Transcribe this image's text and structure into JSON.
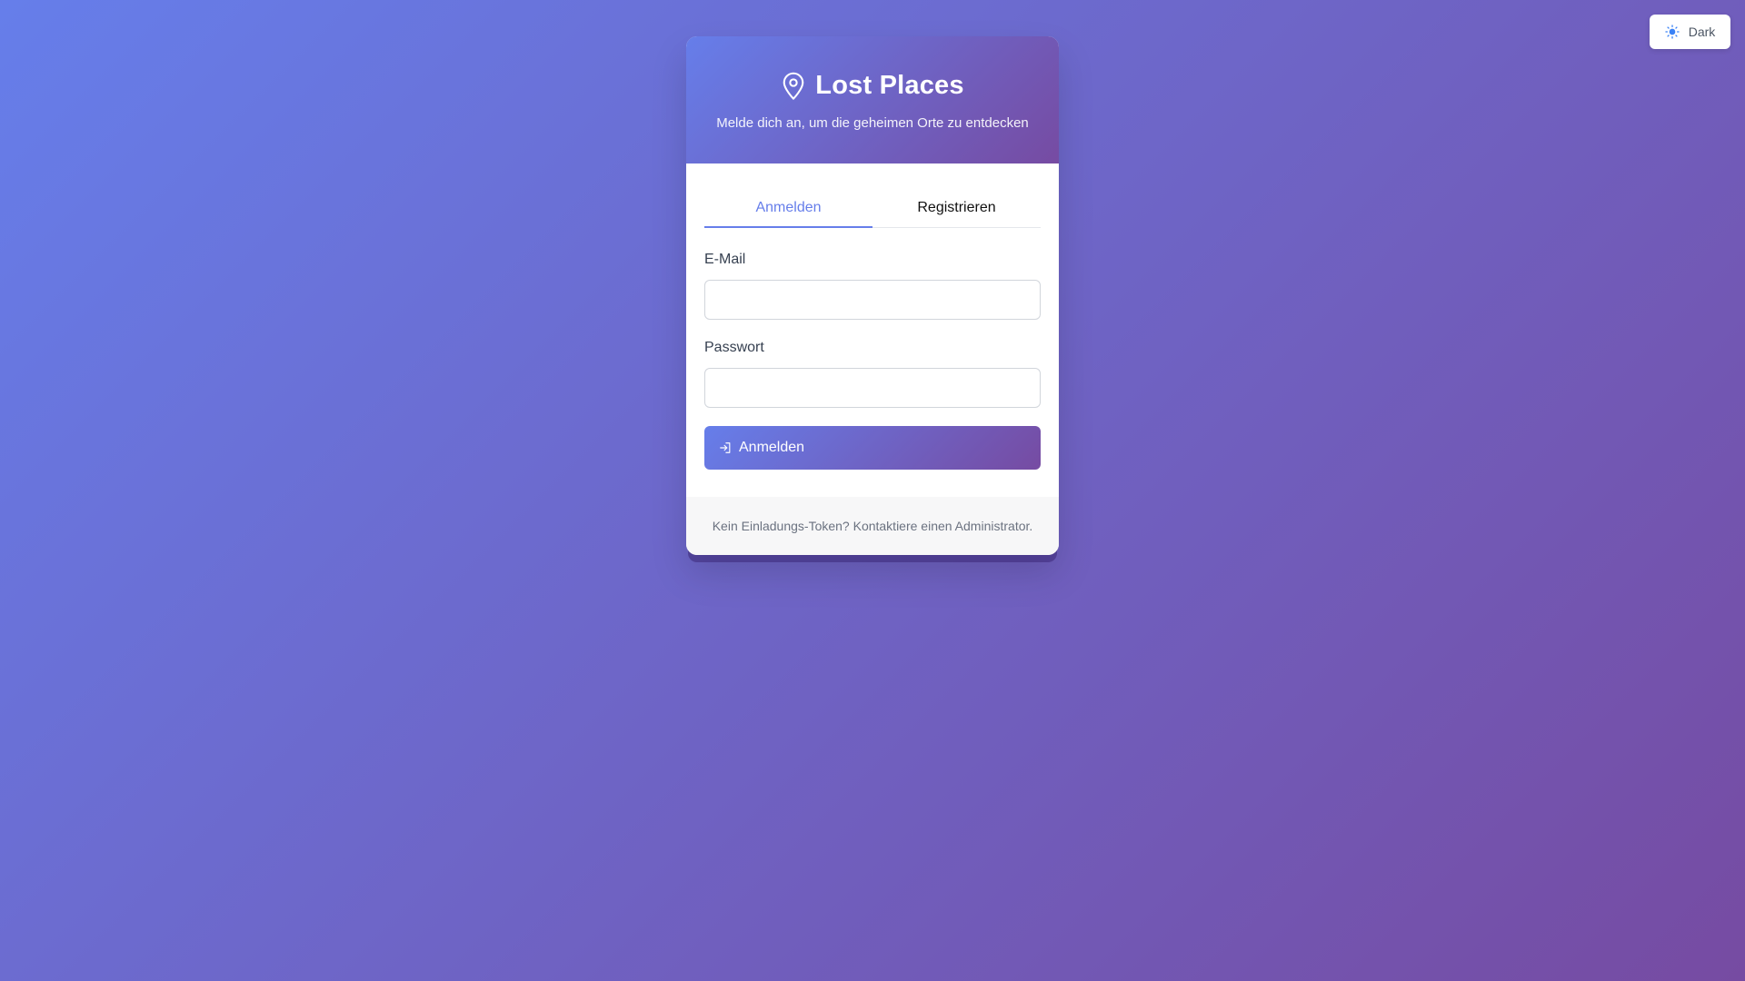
{
  "theme_toggle": {
    "icon": "sun-icon",
    "label": "Dark"
  },
  "header": {
    "icon": "map-pin-icon",
    "title": "Lost Places",
    "subtitle": "Melde dich an, um die geheimen Orte zu entdecken"
  },
  "tabs": [
    {
      "label": "Anmelden",
      "active": true
    },
    {
      "label": "Registrieren",
      "active": false
    }
  ],
  "form": {
    "email_label": "E-Mail",
    "email_value": "",
    "password_label": "Passwort",
    "password_value": "",
    "submit_icon": "login-icon",
    "submit_label": "Anmelden"
  },
  "footer": {
    "text": "Kein Einladungs-Token? Kontaktiere einen Administrator."
  },
  "colors": {
    "gradient_start": "#667eea",
    "gradient_end": "#764ba2",
    "accent": "#667eea"
  }
}
